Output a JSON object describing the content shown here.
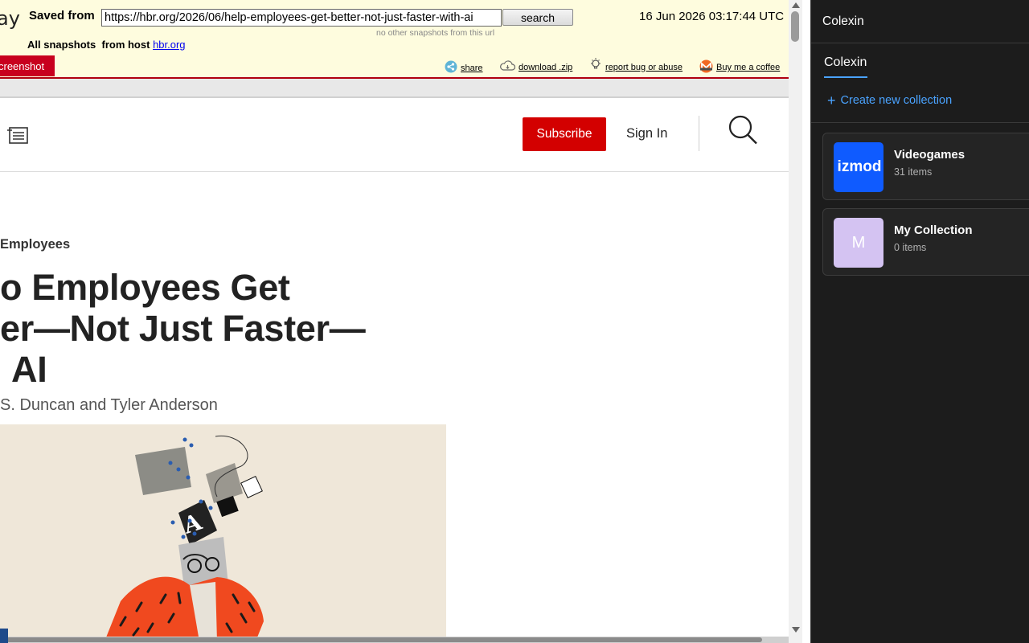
{
  "archive": {
    "brand_fragment": "ay",
    "saved_from_label": "Saved from",
    "url_value": "https://hbr.org/2026/06/help-employees-get-better-not-just-faster-with-ai",
    "search_label": "search",
    "no_snapshots_note": "no other snapshots from this url",
    "timestamp": "16 Jun 2026 03:17:44 UTC",
    "all_snapshots_label": "All snapshots",
    "from_host_label": "from host",
    "host_link": "hbr.org",
    "screenshot_tab": "creenshot",
    "actions": {
      "share": "share",
      "download": "download .zip",
      "report": "report bug or abuse",
      "coffee": "Buy me a coffee"
    }
  },
  "hbr": {
    "subscribe_label": "Subscribe",
    "signin_label": "Sign In",
    "topic": "Employees",
    "headline_lines": [
      "o Employees Get",
      "er—Not Just Faster—",
      "AI"
    ],
    "byline": "S. Duncan and Tyler Anderson"
  },
  "sidebar": {
    "title": "Colexin",
    "tab_label": "Colexin",
    "create_label": "Create new collection",
    "collections": [
      {
        "name": "Videogames",
        "count": "31 items",
        "thumb_text": "izmod",
        "thumb_color": "#0f5bff"
      },
      {
        "name": "My Collection",
        "count": "0 items",
        "thumb_text": "M",
        "thumb_color": "#d4c3f2"
      }
    ]
  },
  "colors": {
    "archive_bg": "#fefcde",
    "archive_accent": "#c8001e",
    "subscribe_red": "#d30000",
    "sidebar_bg": "#1c1c1c",
    "link_blue": "#4aa3ff",
    "hero_bg": "#efe7d9",
    "hero_orange": "#f0491f"
  },
  "icons": [
    "share-icon",
    "download-cloud-icon",
    "bulb-icon",
    "monero-coin-icon",
    "menu-icon",
    "search-icon",
    "plus-icon",
    "chevron-up-icon",
    "chevron-down-icon"
  ]
}
